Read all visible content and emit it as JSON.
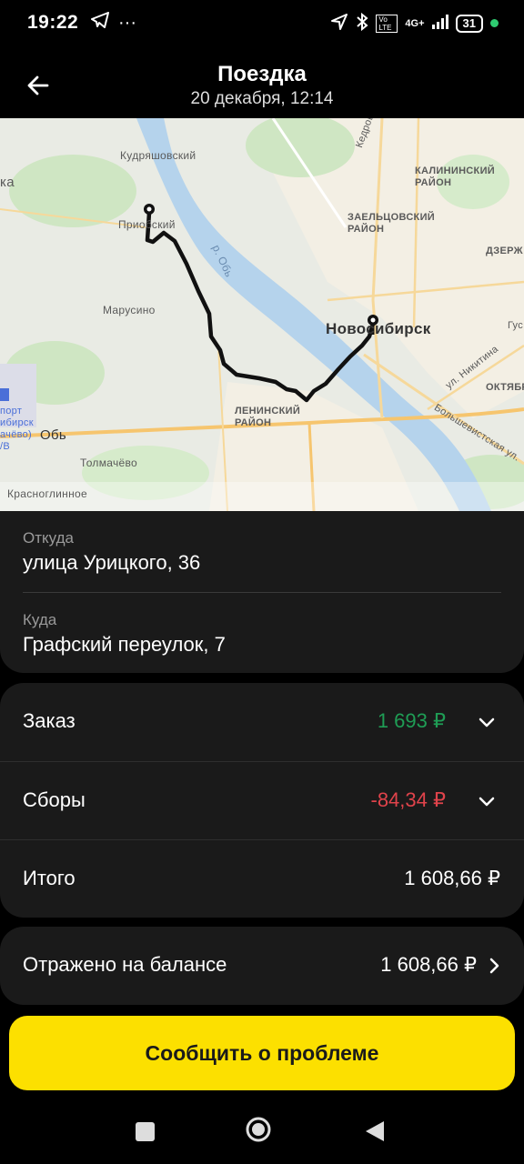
{
  "status_bar": {
    "time": "19:22",
    "network": "4G+",
    "volte": "Vo LTE",
    "battery": "31"
  },
  "header": {
    "title": "Поездка",
    "subtitle": "20 декабря, 12:14"
  },
  "map": {
    "labels": {
      "kudryashovsky": "Кудряшовский",
      "ka": "ка",
      "prirechny": "Приобский",
      "marusino": "Марусино",
      "ob_river": "р. Обь",
      "novosibirsk": "Новосибирск",
      "leninsky": "ЛЕНИНСКИЙ РАЙОН",
      "zaeltsovsky": "ЗАЕЛЬЦОВСКИЙ РАЙОН",
      "kalininsky": "КАЛИНИНСКИЙ РАЙОН",
      "oktyabrsky": "ОКТЯБР",
      "dzerzh": "ДЗЕРЖ",
      "ob": "Обь",
      "tolmachevo": "Толмачёво",
      "krasnoglinnoe": "Красноглинное",
      "port": "порт",
      "sibirsk": "ибирск",
      "achevo": "ачёво)",
      "vb": "/В",
      "nikitina": "ул. Никитина",
      "bolshevistskaya": "Большевистская ул.",
      "kedrovaya": "Кедров",
      "gus": "Гус"
    }
  },
  "route": {
    "from_label": "Откуда",
    "from_value": "улица Урицкого, 36",
    "to_label": "Куда",
    "to_value": "Графский переулок, 7"
  },
  "fare": {
    "order_label": "Заказ",
    "order_value": "1 693 ₽",
    "fees_label": "Сборы",
    "fees_value": "-84,34 ₽",
    "total_label": "Итого",
    "total_value": "1 608,66 ₽",
    "colors": {
      "positive": "#1f9d55",
      "negative": "#e0434b"
    }
  },
  "balance": {
    "label": "Отражено на балансе",
    "value": "1 608,66 ₽"
  },
  "report_button": {
    "label": "Сообщить о проблеме",
    "color": "#fce000"
  }
}
